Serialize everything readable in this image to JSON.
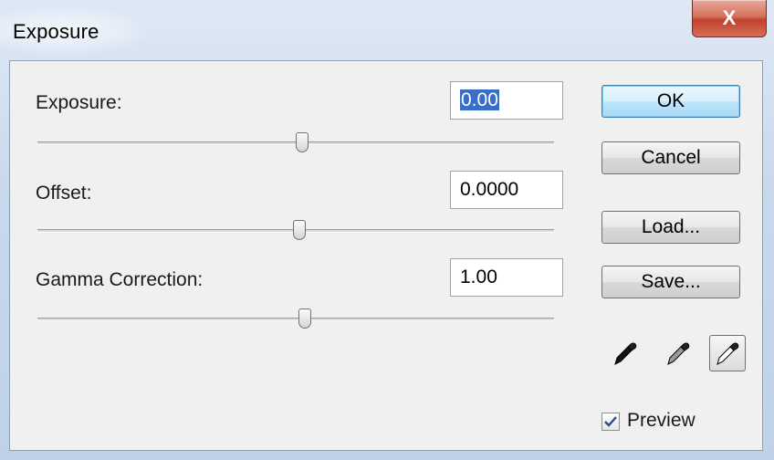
{
  "window": {
    "title": "Exposure",
    "close_label": "X"
  },
  "fields": {
    "exposure": {
      "label": "Exposure:",
      "value": "0.00",
      "slider_position": 0.5
    },
    "offset": {
      "label": "Offset:",
      "value": "0.0000",
      "slider_position": 0.5
    },
    "gamma": {
      "label": "Gamma Correction:",
      "value": "1.00",
      "slider_position": 0.5
    }
  },
  "buttons": {
    "ok": "OK",
    "cancel": "Cancel",
    "load": "Load...",
    "save": "Save..."
  },
  "eyedroppers": [
    "black-point-eyedropper-icon",
    "gray-point-eyedropper-icon",
    "white-point-eyedropper-icon"
  ],
  "preview": {
    "label": "Preview",
    "checked": true
  },
  "colors": {
    "selection": "#3a6fc9",
    "default_button": "#a7d9f5",
    "close_button": "#c2412b"
  }
}
